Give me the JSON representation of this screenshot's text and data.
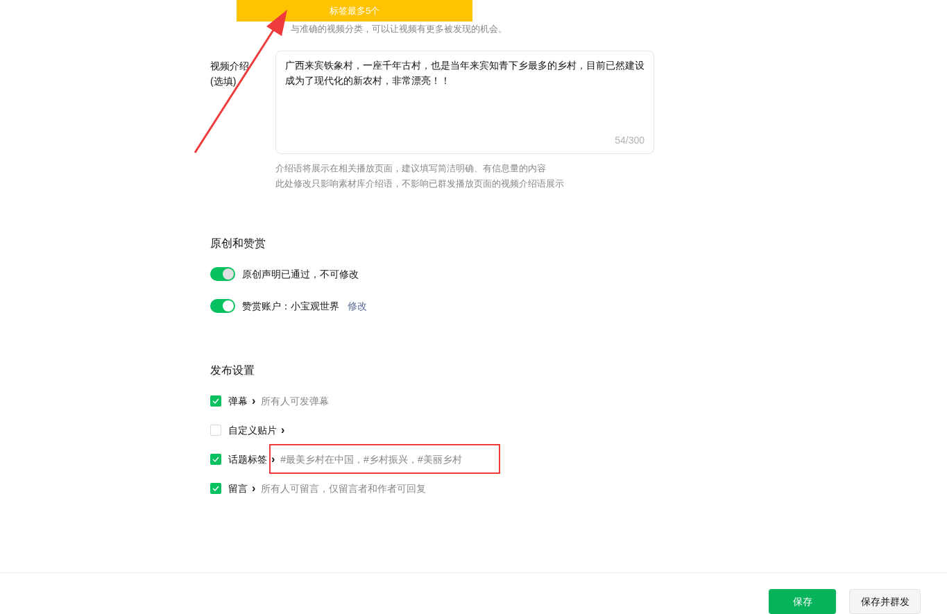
{
  "banner": {
    "text": "标签最多5个"
  },
  "category_hint": "与准确的视频分类，可以让视频有更多被发现的机会。",
  "intro": {
    "label": "视频介绍",
    "label_note": "(选填)",
    "value": "广西来宾铁象村，一座千年古村，也是当年来宾知青下乡最多的乡村，目前已然建设成为了现代化的新农村，非常漂亮！！",
    "counter": "54/300",
    "hints": [
      "介绍语将展示在相关播放页面，建议填写简洁明确、有信息量的内容",
      "此处修改只影响素材库介绍语，不影响已群发播放页面的视频介绍语展示"
    ]
  },
  "original_section": {
    "title": "原创和赞赏",
    "toggles": [
      {
        "label": "原创声明已通过，不可修改",
        "on": true,
        "disabled": true
      },
      {
        "label": "赞赏账户：小宝观世界",
        "on": true,
        "disabled": false,
        "link": "修改"
      }
    ]
  },
  "publish_section": {
    "title": "发布设置",
    "options": [
      {
        "label": "弹幕",
        "checked": true,
        "chevron": "›",
        "value": "所有人可发弹幕",
        "highlighted": false
      },
      {
        "label": "自定义贴片",
        "checked": false,
        "chevron": "›",
        "highlighted": false
      },
      {
        "label": "话题标签",
        "checked": true,
        "chevron": "›",
        "value": "#最美乡村在中国，#乡村振兴，#美丽乡村",
        "highlighted": true
      },
      {
        "label": "留言",
        "checked": true,
        "chevron": "›",
        "value": "所有人可留言，仅留言者和作者可回复",
        "highlighted": false
      }
    ]
  },
  "footer": {
    "buttons": [
      {
        "label": "保存",
        "kind": "primary"
      },
      {
        "label": "保存并群发",
        "kind": "secondary"
      }
    ]
  }
}
